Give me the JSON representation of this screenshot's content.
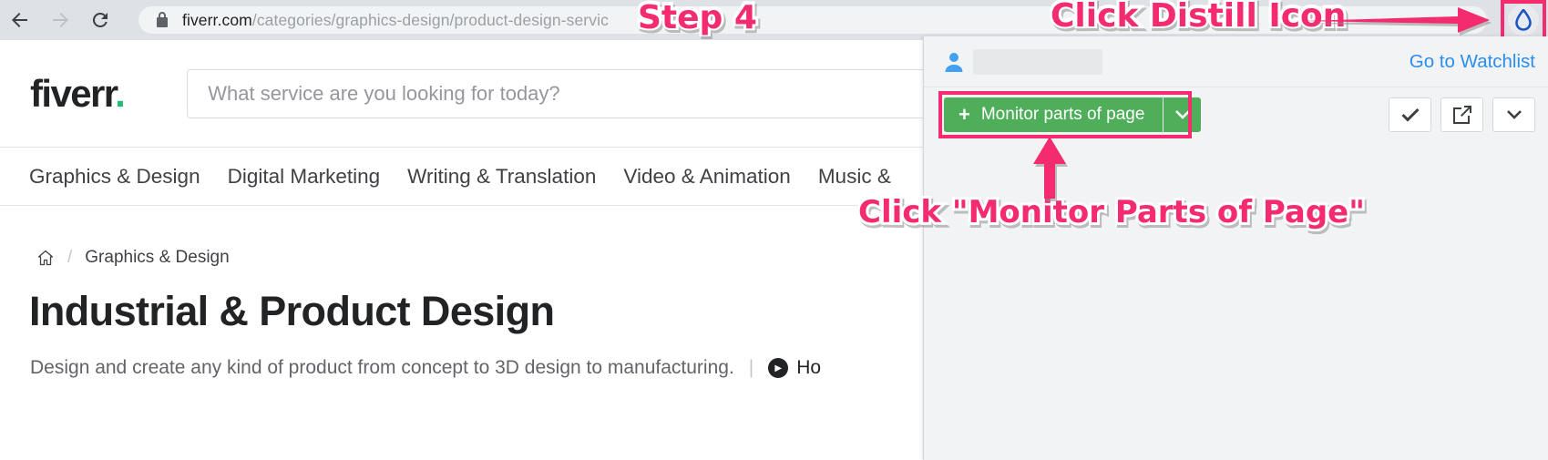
{
  "browser": {
    "back_icon": "arrow-left-icon",
    "forward_icon": "arrow-right-icon",
    "reload_icon": "reload-icon",
    "lock_icon": "padlock-icon",
    "url_host": "fiverr.com",
    "url_path": "/categories/graphics-design/product-design-servic",
    "extension_icon": "distill-droplet-icon",
    "highlight_color": "#f42b6e"
  },
  "site": {
    "logo_text": "fiverr",
    "logo_dot": ".",
    "logo_dot_color": "#1dbf73",
    "search": {
      "placeholder": "What service are you looking for today?",
      "icon": "search-input"
    },
    "nav_items": [
      "Graphics & Design",
      "Digital Marketing",
      "Writing & Translation",
      "Video & Animation",
      "Music &"
    ],
    "breadcrumb": {
      "home_icon": "home-icon",
      "separator": "/",
      "current": "Graphics & Design"
    },
    "page_title": "Industrial & Product Design",
    "description": "Design and create any kind of product from concept to 3D design to manufacturing.",
    "description_divider": "|",
    "how_link": "Ho",
    "play_icon": "play-circle-icon"
  },
  "popup": {
    "account_icon": "person-icon",
    "account_name_redacted": "",
    "watchlist_link": "Go to Watchlist",
    "monitor_button": {
      "label": "Monitor parts of page",
      "plus_icon": "plus-icon",
      "caret_icon": "chevron-down-icon",
      "color": "#4fae5a"
    },
    "toolbar_buttons": [
      {
        "name": "check-icon",
        "glyph": "check"
      },
      {
        "name": "external-link-icon",
        "glyph": "external"
      },
      {
        "name": "chevron-down-icon",
        "glyph": "caret"
      }
    ]
  },
  "annotations": {
    "step": "Step 4",
    "click_distill": "Click Distill Icon",
    "click_monitor": "Click \"Monitor Parts of Page\"",
    "color": "#f42b6e",
    "arrow_to_distill": "arrow-right-icon",
    "arrow_to_monitor": "arrow-up-icon"
  }
}
